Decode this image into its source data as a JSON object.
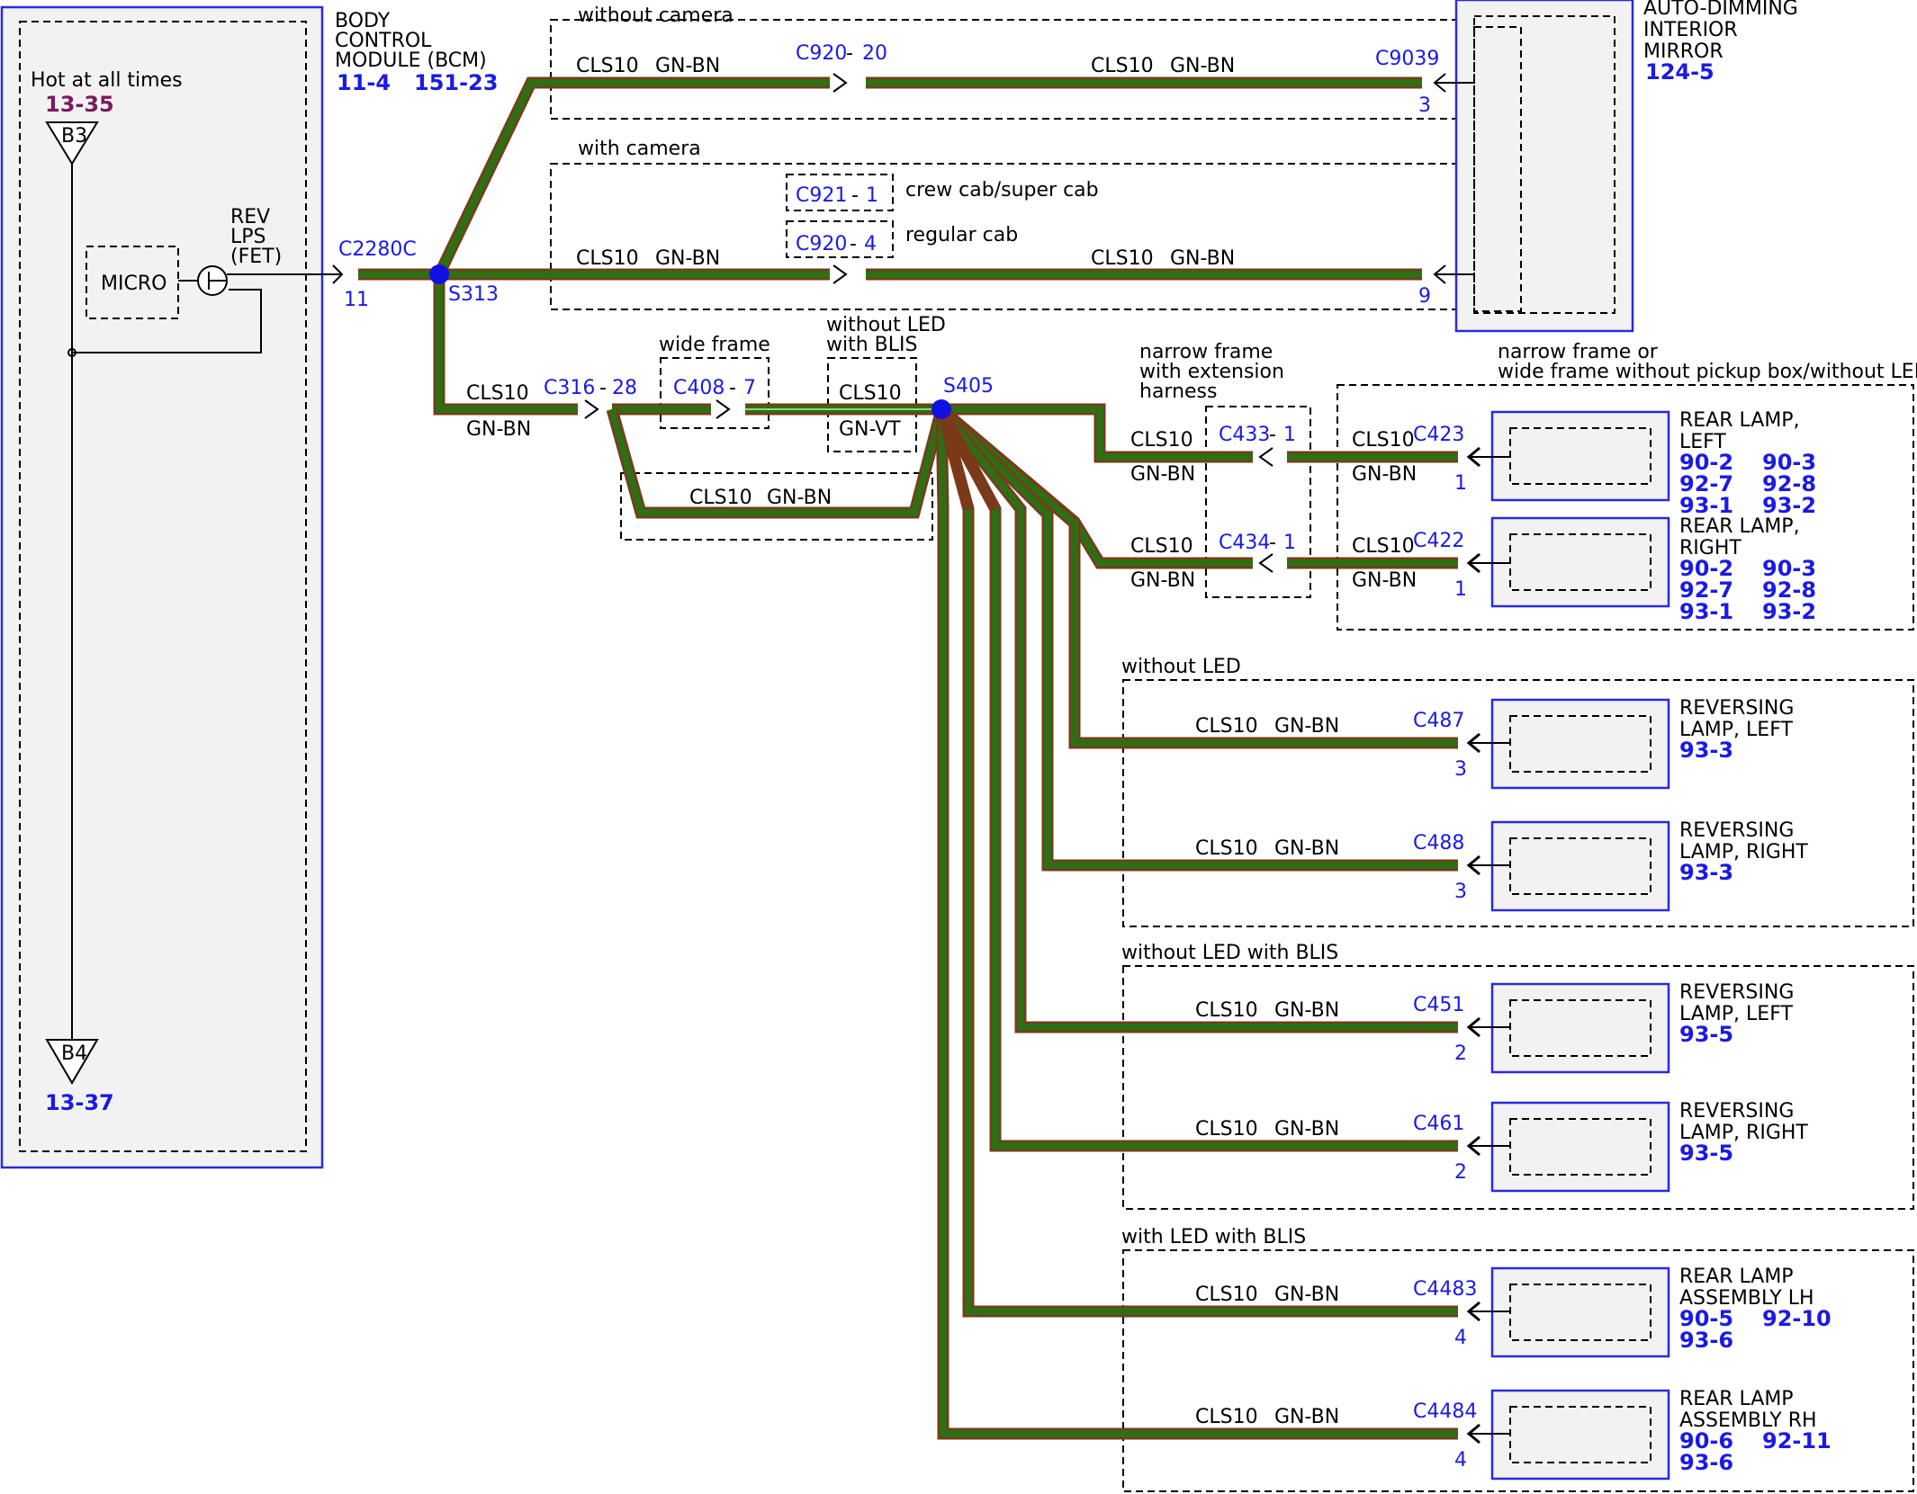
{
  "bcm": {
    "title_lines": [
      "BODY",
      "CONTROL",
      "MODULE (BCM)"
    ],
    "refs": [
      "11-4",
      "151-23"
    ],
    "hot_label": "Hot at all times",
    "hot_ref": "13-35",
    "pin_top": "B3",
    "pin_bottom": "B4",
    "bottom_ref": "13-37",
    "micro": "MICRO",
    "rev_lines": [
      "REV",
      "LPS",
      "(FET)"
    ],
    "connector": "C2280C",
    "pin": "11"
  },
  "splices": {
    "s313": "S313",
    "s405": "S405"
  },
  "wire": {
    "circuit": "CLS10",
    "color": "GN-BN",
    "color_vt": "GN-VT"
  },
  "mirror": {
    "title_lines": [
      "AUTO-DIMMING",
      "INTERIOR",
      "MIRROR"
    ],
    "ref": "124-5",
    "without_camera": "without camera",
    "with_camera": "with camera",
    "c920_20": "C920",
    "c920_20_pin": "20",
    "c9039": "C9039",
    "c9039_pin": "3",
    "c921": "C921",
    "c921_pin": "1",
    "crew_cab": "crew cab/super cab",
    "c920_4": "C920",
    "c920_4_pin": "4",
    "regular_cab": "regular cab",
    "pin9": "9"
  },
  "harness": {
    "c316": "C316",
    "c316_pin": "28",
    "wide_frame": "wide frame",
    "c408": "C408",
    "c408_pin": "7",
    "without_led_blis_lines": [
      "without LED",
      "with BLIS"
    ]
  },
  "narrow": {
    "label_lines": [
      "narrow frame",
      "with extension",
      "harness"
    ],
    "group_lines": [
      "narrow frame or",
      "wide frame without pickup box/without LED"
    ],
    "c433": "C433",
    "c433_pin": "1",
    "c434": "C434",
    "c434_pin": "1"
  },
  "groups": {
    "without_led": "without LED",
    "without_led_blis": "without LED with BLIS",
    "with_led_blis": "with LED with BLIS"
  },
  "lamps": [
    {
      "id": "c423",
      "conn": "C423",
      "pin": "1",
      "name_lines": [
        "REAR LAMP,",
        "LEFT"
      ],
      "refs": [
        [
          "90-2",
          "90-3"
        ],
        [
          "92-7",
          "92-8"
        ],
        [
          "93-1",
          "93-2"
        ]
      ]
    },
    {
      "id": "c422",
      "conn": "C422",
      "pin": "1",
      "name_lines": [
        "REAR LAMP,",
        "RIGHT"
      ],
      "refs": [
        [
          "90-2",
          "90-3"
        ],
        [
          "92-7",
          "92-8"
        ],
        [
          "93-1",
          "93-2"
        ]
      ]
    },
    {
      "id": "c487",
      "conn": "C487",
      "pin": "3",
      "name_lines": [
        "REVERSING",
        "LAMP, LEFT"
      ],
      "refs": [
        [
          "93-3"
        ]
      ]
    },
    {
      "id": "c488",
      "conn": "C488",
      "pin": "3",
      "name_lines": [
        "REVERSING",
        "LAMP, RIGHT"
      ],
      "refs": [
        [
          "93-3"
        ]
      ]
    },
    {
      "id": "c451",
      "conn": "C451",
      "pin": "2",
      "name_lines": [
        "REVERSING",
        "LAMP, LEFT"
      ],
      "refs": [
        [
          "93-5"
        ]
      ]
    },
    {
      "id": "c461",
      "conn": "C461",
      "pin": "2",
      "name_lines": [
        "REVERSING",
        "LAMP, RIGHT"
      ],
      "refs": [
        [
          "93-5"
        ]
      ]
    },
    {
      "id": "c4483",
      "conn": "C4483",
      "pin": "4",
      "name_lines": [
        "REAR LAMP",
        "ASSEMBLY LH"
      ],
      "refs": [
        [
          "90-5",
          "92-10"
        ],
        [
          "93-6"
        ]
      ]
    },
    {
      "id": "c4484",
      "conn": "C4484",
      "pin": "4",
      "name_lines": [
        "REAR LAMP",
        "ASSEMBLY RH"
      ],
      "refs": [
        [
          "90-6",
          "92-11"
        ],
        [
          "93-6"
        ]
      ]
    }
  ],
  "colors": {
    "wire_fill": "#2e6e14",
    "wire_edge": "#7a3a1a",
    "module_border": "#2a2ae0",
    "connector_text": "#1a1ae6",
    "ref_hot": "#7a1a5e"
  }
}
